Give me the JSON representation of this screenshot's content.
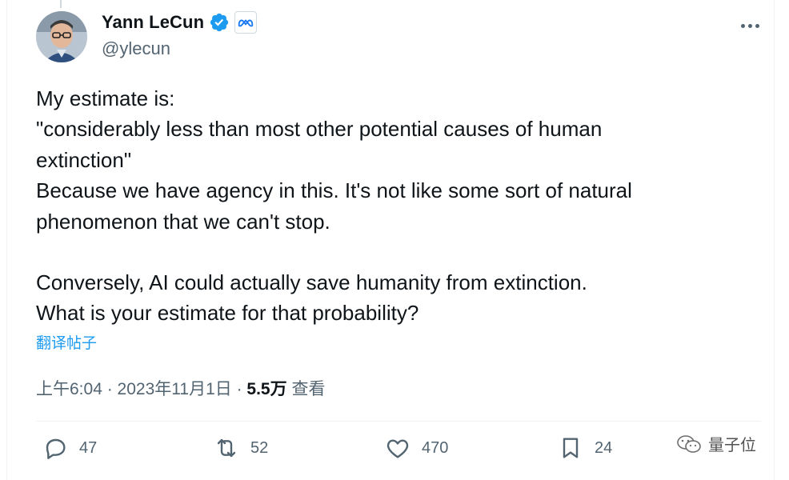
{
  "user": {
    "name": "Yann LeCun",
    "handle": "@ylecun",
    "verified_color": "#1d9bf0",
    "affiliation_icon": "meta-logo-icon"
  },
  "tweet": {
    "lines": [
      "My estimate is:",
      "\"considerably less than most other potential causes of human",
      "extinction\"",
      "Because we have agency in this. It's not like some sort of natural",
      "phenomenon that we can't stop.",
      "Conversely, AI could actually save humanity from extinction.",
      "What is your estimate for that probability?"
    ],
    "translate_label": "翻译帖子"
  },
  "meta": {
    "time": "上午6:04",
    "sep1": " · ",
    "date": "2023年11月1日",
    "sep2": " · ",
    "views_count": "5.5万",
    "views_label": " 查看"
  },
  "actions": {
    "replies": "47",
    "reposts": "52",
    "likes": "470",
    "bookmarks": "24"
  },
  "watermark": {
    "label": "量子位"
  },
  "colors": {
    "text": "#0f1419",
    "secondary": "#536471",
    "accent": "#1d9bf0"
  }
}
